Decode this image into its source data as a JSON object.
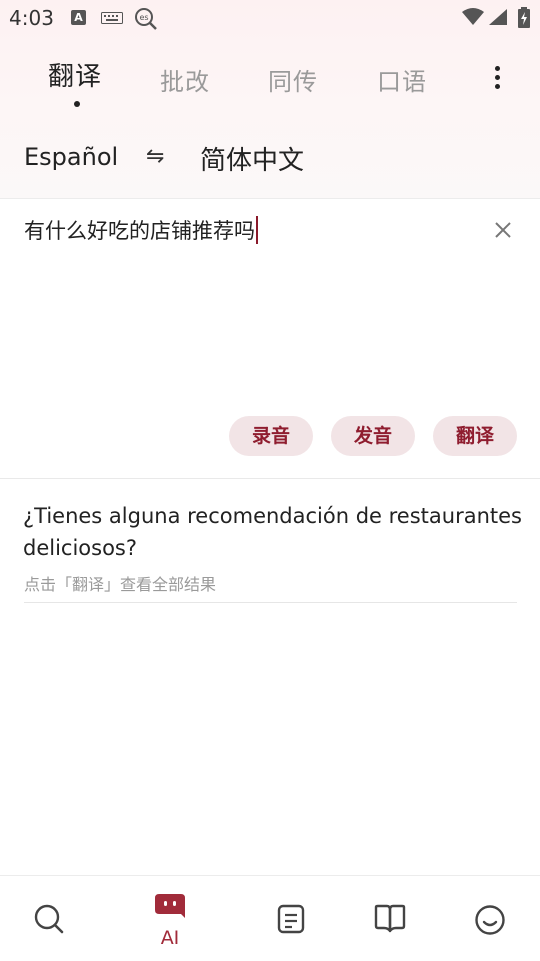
{
  "status_bar": {
    "time": "4:03",
    "icons": [
      "keyboard-a-icon",
      "keyboard-icon",
      "es-search-icon",
      "wifi-icon",
      "signal-icon",
      "battery-icon"
    ]
  },
  "tabs": [
    {
      "label": "翻译",
      "active": true
    },
    {
      "label": "批改",
      "active": false
    },
    {
      "label": "同传",
      "active": false
    },
    {
      "label": "口语",
      "active": false
    }
  ],
  "languages": {
    "source": "Español",
    "swap_icon": "⇋",
    "target": "简体中文"
  },
  "input": {
    "value": "有什么好吃的店铺推荐吗"
  },
  "actions": {
    "record": "录音",
    "speak": "发音",
    "translate": "翻译"
  },
  "result": {
    "text": "¿Tienes alguna recomendación de restaurantes deliciosos?",
    "hint": "点击「翻译」查看全部结果"
  },
  "bottom_nav": [
    {
      "icon": "search-icon",
      "label": ""
    },
    {
      "icon": "ai-robot-icon",
      "label": "AI",
      "active": true
    },
    {
      "icon": "notes-icon",
      "label": ""
    },
    {
      "icon": "book-icon",
      "label": ""
    },
    {
      "icon": "smiley-icon",
      "label": ""
    }
  ],
  "colors": {
    "accent": "#a12b3a",
    "pill_bg": "#f2e4e6",
    "top_bg": "#fdf1f2"
  }
}
